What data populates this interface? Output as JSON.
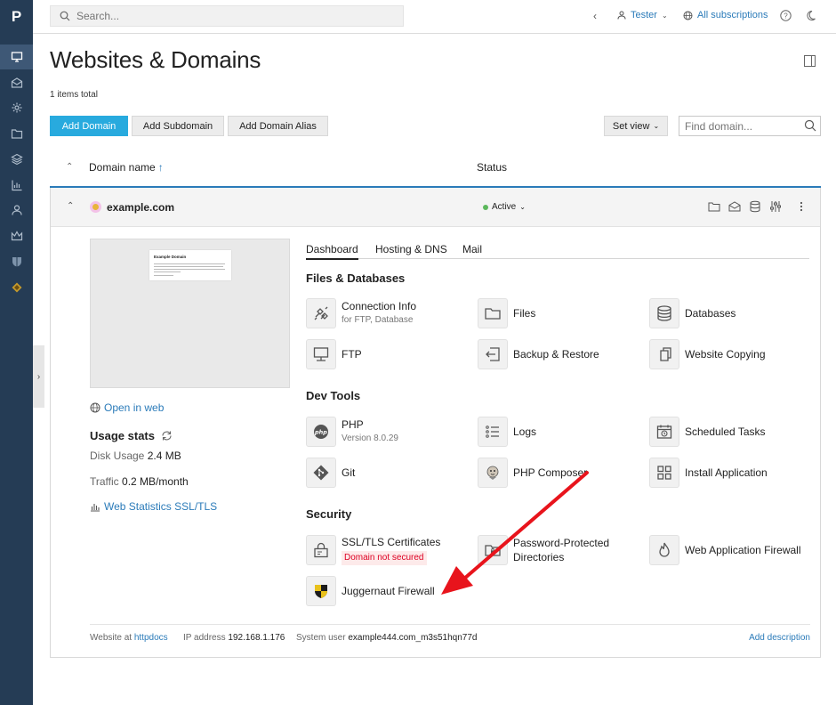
{
  "app": {
    "logo": "P"
  },
  "sidebar": {
    "items": [
      "monitor-icon",
      "mail-icon",
      "gear-icon",
      "folder-icon",
      "layers-icon",
      "chart-icon",
      "user-icon",
      "crown-icon",
      "shield-icon",
      "extension-icon"
    ]
  },
  "topbar": {
    "search_placeholder": "Search...",
    "user_label": "Tester",
    "subscriptions_label": "All subscriptions"
  },
  "page": {
    "title": "Websites & Domains",
    "items_total": "1 items total"
  },
  "actions": {
    "add_domain": "Add Domain",
    "add_subdomain": "Add Subdomain",
    "add_domain_alias": "Add Domain Alias",
    "set_view": "Set view",
    "find_placeholder": "Find domain..."
  },
  "table": {
    "col_domain": "Domain name",
    "col_status": "Status"
  },
  "domain": {
    "name": "example.com",
    "status": "Active",
    "preview_title": "Example Domain",
    "open_in_web": "Open in web",
    "usage_title": "Usage stats",
    "disk_label": "Disk Usage",
    "disk_value": "2.4 MB",
    "traffic_label": "Traffic",
    "traffic_value": "0.2 MB/month",
    "web_stats": "Web Statistics SSL/TLS"
  },
  "tabs": [
    "Dashboard",
    "Hosting & DNS",
    "Mail"
  ],
  "sections": {
    "files": "Files & Databases",
    "dev": "Dev Tools",
    "security": "Security"
  },
  "tools": {
    "connection_info": {
      "name": "Connection Info",
      "sub": "for FTP, Database"
    },
    "files": {
      "name": "Files"
    },
    "databases": {
      "name": "Databases"
    },
    "ftp": {
      "name": "FTP"
    },
    "backup": {
      "name": "Backup & Restore"
    },
    "website_copying": {
      "name": "Website Copying"
    },
    "php": {
      "name": "PHP",
      "sub": "Version 8.0.29"
    },
    "logs": {
      "name": "Logs"
    },
    "scheduled": {
      "name": "Scheduled Tasks"
    },
    "git": {
      "name": "Git"
    },
    "composer": {
      "name": "PHP Composer"
    },
    "install_app": {
      "name": "Install Application"
    },
    "ssl": {
      "name": "SSL/TLS Certificates",
      "badge": "Domain not secured"
    },
    "ppd": {
      "name": "Password-Protected Directories"
    },
    "waf": {
      "name": "Web Application Firewall"
    },
    "juggernaut": {
      "name": "Juggernaut Firewall"
    }
  },
  "footer": {
    "website_at_label": "Website at",
    "website_at_value": "httpdocs",
    "ip_label": "IP address",
    "ip_value": "192.168.1.176",
    "sysuser_label": "System user",
    "sysuser_value": "example444.com_m3s51hqn77d",
    "add_description": "Add description"
  },
  "colors": {
    "sidebar": "#253c55",
    "accent": "#28aade",
    "link": "#2b7bb9",
    "arrow": "#e8141c"
  }
}
